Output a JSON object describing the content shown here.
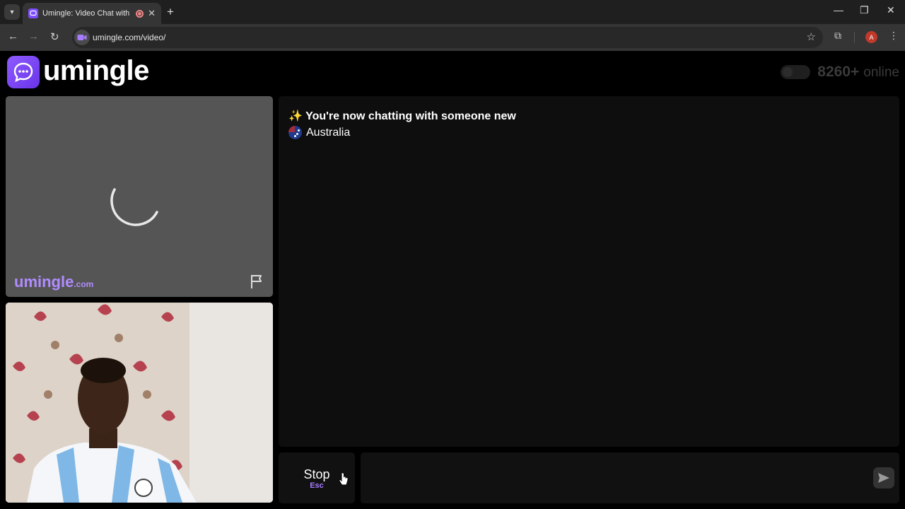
{
  "browser": {
    "tab_title": "Umingle: Video Chat with St",
    "url": "umingle.com/video/",
    "profile_initial": "A"
  },
  "header": {
    "logo_text": "umingle",
    "online_count": "8260+",
    "online_label": "online"
  },
  "stranger_video": {
    "watermark": "umingle",
    "watermark_suffix": ".com"
  },
  "chat": {
    "status_message": "You're now chatting with someone new",
    "status_icon": "sparkles",
    "country": "Australia"
  },
  "controls": {
    "stop_label": "Stop",
    "stop_shortcut": "Esc",
    "input_placeholder": ""
  },
  "colors": {
    "brand": "#8e5bff",
    "shortcut": "#a77cff"
  }
}
